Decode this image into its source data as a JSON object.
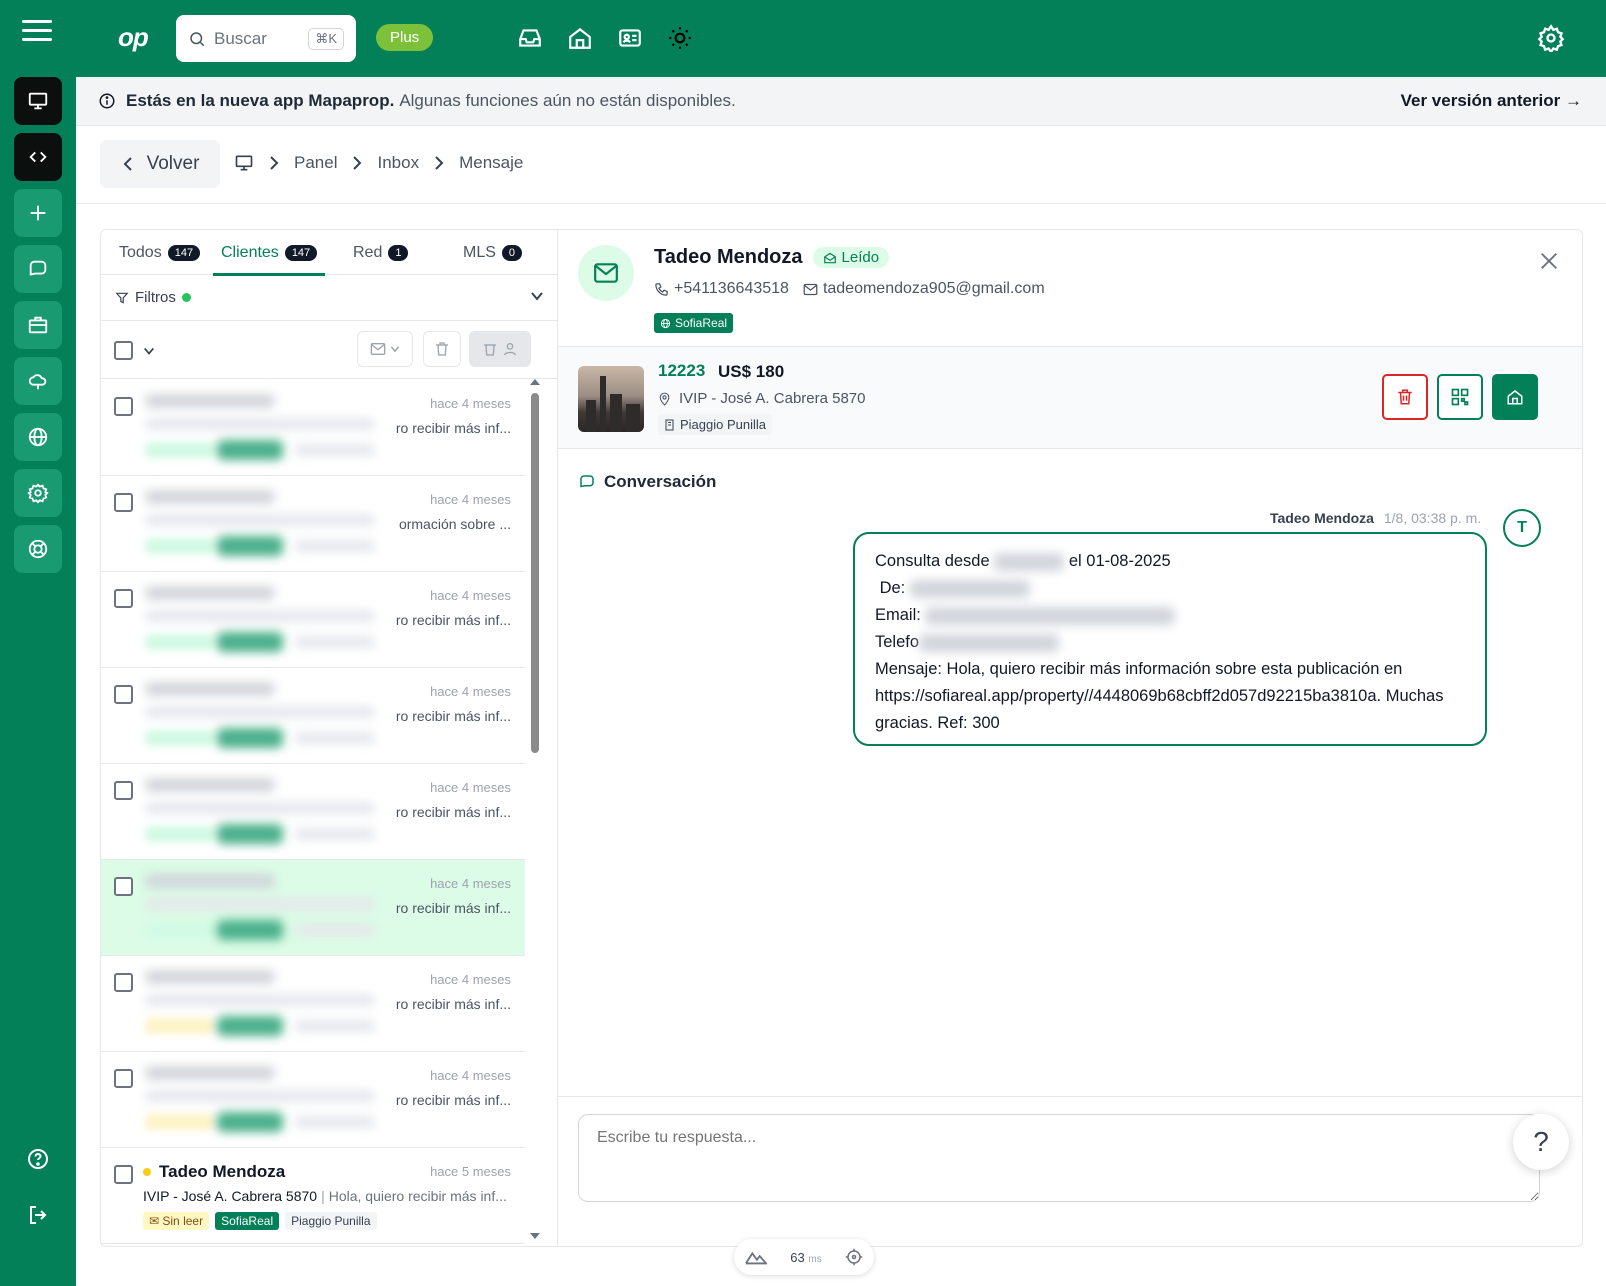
{
  "topbar": {
    "logo": "op",
    "search_placeholder": "Buscar",
    "search_shortcut": "⌘K",
    "plan_badge": "Plus"
  },
  "banner": {
    "bold_text": "Estás en la nueva app Mapaprop.",
    "light_text": "Algunas funciones aún no están disponibles.",
    "link": "Ver versión anterior →"
  },
  "breadcrumb": {
    "back_label": "Volver",
    "items": [
      "Panel",
      "Inbox",
      "Mensaje"
    ]
  },
  "tabs": [
    {
      "label": "Todos",
      "count": "147"
    },
    {
      "label": "Clientes",
      "count": "147"
    },
    {
      "label": "Red",
      "count": "1"
    },
    {
      "label": "MLS",
      "count": "0"
    }
  ],
  "filters": {
    "label": "Filtros"
  },
  "messages": [
    {
      "time": "hace 4 meses",
      "snippet": "ro recibir más inf..."
    },
    {
      "time": "hace 4 meses",
      "snippet": "ormación sobre ..."
    },
    {
      "time": "hace 4 meses",
      "snippet": "ro recibir más inf..."
    },
    {
      "time": "hace 4 meses",
      "snippet": "ro recibir más inf..."
    },
    {
      "time": "hace 4 meses",
      "snippet": "ro recibir más inf..."
    },
    {
      "time": "hace 4 meses",
      "snippet": "ro recibir más inf..."
    },
    {
      "time": "hace 4 meses",
      "snippet": "ro recibir más inf..."
    },
    {
      "time": "hace 4 meses",
      "snippet": "ro recibir más inf..."
    }
  ],
  "last_message": {
    "name": "Tadeo Mendoza",
    "time": "hace 5 meses",
    "property": "IVIP - José A. Cabrera 5870",
    "preview": "Hola, quiero recibir más inf...",
    "tag_unread": "Sin leer",
    "tag_source": "SofiaReal",
    "tag_agent": "Piaggio Punilla"
  },
  "contact": {
    "name": "Tadeo Mendoza",
    "status": "Leído",
    "phone": "+541136643518",
    "email": "tadeomendoza905@gmail.com",
    "source": "SofiaReal"
  },
  "property": {
    "code": "12223",
    "price": "US$ 180",
    "address": "IVIP - José A. Cabrera 5870",
    "agent": "Piaggio Punilla"
  },
  "conversation": {
    "title": "Conversación",
    "sender": "Tadeo Mendoza",
    "when": "1/8, 03:38 p. m.",
    "avatar_initial": "T",
    "line1_a": "Consulta desde",
    "line1_b": "el 01-08-2025",
    "line2": "De:",
    "line3": "Email:",
    "line4": "Telefo",
    "line5": "Mensaje: Hola, quiero recibir más información sobre esta publicación en https://sofiareal.app/property//4448069b68cbff2d057d92215ba3810a. Muchas gracias. Ref: 300"
  },
  "reply": {
    "placeholder": "Escribe tu respuesta..."
  },
  "help": {
    "label": "?"
  },
  "perf": {
    "value": "63",
    "unit": "ms"
  },
  "colors": {
    "brand": "#038057",
    "danger": "#dc2626",
    "badge_green": "#7dc13a"
  }
}
